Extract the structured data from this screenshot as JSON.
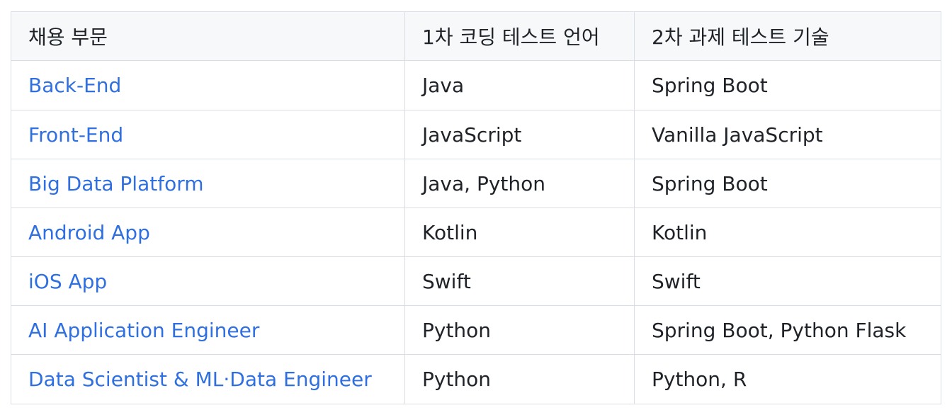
{
  "table": {
    "headers": [
      "채용 부문",
      "1차 코딩 테스트 언어",
      "2차 과제 테스트 기술"
    ],
    "rows": [
      {
        "department": "Back-End",
        "coding_language": "Java",
        "assignment_tech": "Spring Boot"
      },
      {
        "department": "Front-End",
        "coding_language": "JavaScript",
        "assignment_tech": "Vanilla JavaScript"
      },
      {
        "department": "Big Data Platform",
        "coding_language": "Java, Python",
        "assignment_tech": "Spring Boot"
      },
      {
        "department": "Android App",
        "coding_language": "Kotlin",
        "assignment_tech": "Kotlin"
      },
      {
        "department": "iOS App",
        "coding_language": "Swift",
        "assignment_tech": "Swift"
      },
      {
        "department": "AI Application Engineer",
        "coding_language": "Python",
        "assignment_tech": "Spring Boot, Python Flask"
      },
      {
        "department": "Data Scientist & ML·Data Engineer",
        "coding_language": "Python",
        "assignment_tech": "Python, R"
      }
    ]
  },
  "colors": {
    "link": "#2f6fe0",
    "header_bg": "#f6f8fa",
    "border": "#d8dee4",
    "text": "#1f2328"
  }
}
